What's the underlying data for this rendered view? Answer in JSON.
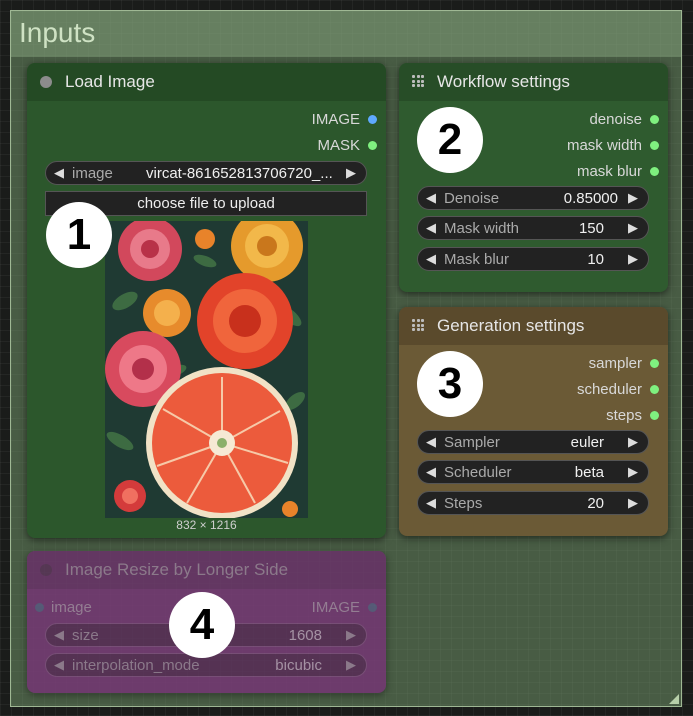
{
  "group": {
    "title": "Inputs"
  },
  "load_image": {
    "title": "Load Image",
    "outputs": [
      "IMAGE",
      "MASK"
    ],
    "image_widget": {
      "label": "image",
      "value": "vircat-861652813706720_..."
    },
    "upload_button": "choose file to upload",
    "dimensions": "832 × 1216",
    "callout": "1"
  },
  "workflow": {
    "title": "Workflow settings",
    "outputs": [
      "denoise",
      "mask width",
      "mask blur"
    ],
    "widgets": [
      {
        "label": "Denoise",
        "value": "0.85000"
      },
      {
        "label": "Mask width",
        "value": "150"
      },
      {
        "label": "Mask blur",
        "value": "10"
      }
    ],
    "callout": "2"
  },
  "generation": {
    "title": "Generation settings",
    "outputs": [
      "sampler",
      "scheduler",
      "steps"
    ],
    "widgets": [
      {
        "label": "Sampler",
        "value": "euler"
      },
      {
        "label": "Scheduler",
        "value": "beta"
      },
      {
        "label": "Steps",
        "value": "20"
      }
    ],
    "callout": "3"
  },
  "resize": {
    "title": "Image Resize by Longer Side",
    "input": "image",
    "output": "IMAGE",
    "widgets": [
      {
        "label": "size",
        "value": "1608"
      },
      {
        "label": "interpolation_mode",
        "value": "bicubic"
      }
    ],
    "callout": "4"
  },
  "colors": {
    "load_node_bg": "#2b5a2b",
    "workflow_node_bg": "#2f5e2f",
    "generation_node_bg": "#6b5a37",
    "resize_node_bg": "#7a2d7a"
  }
}
